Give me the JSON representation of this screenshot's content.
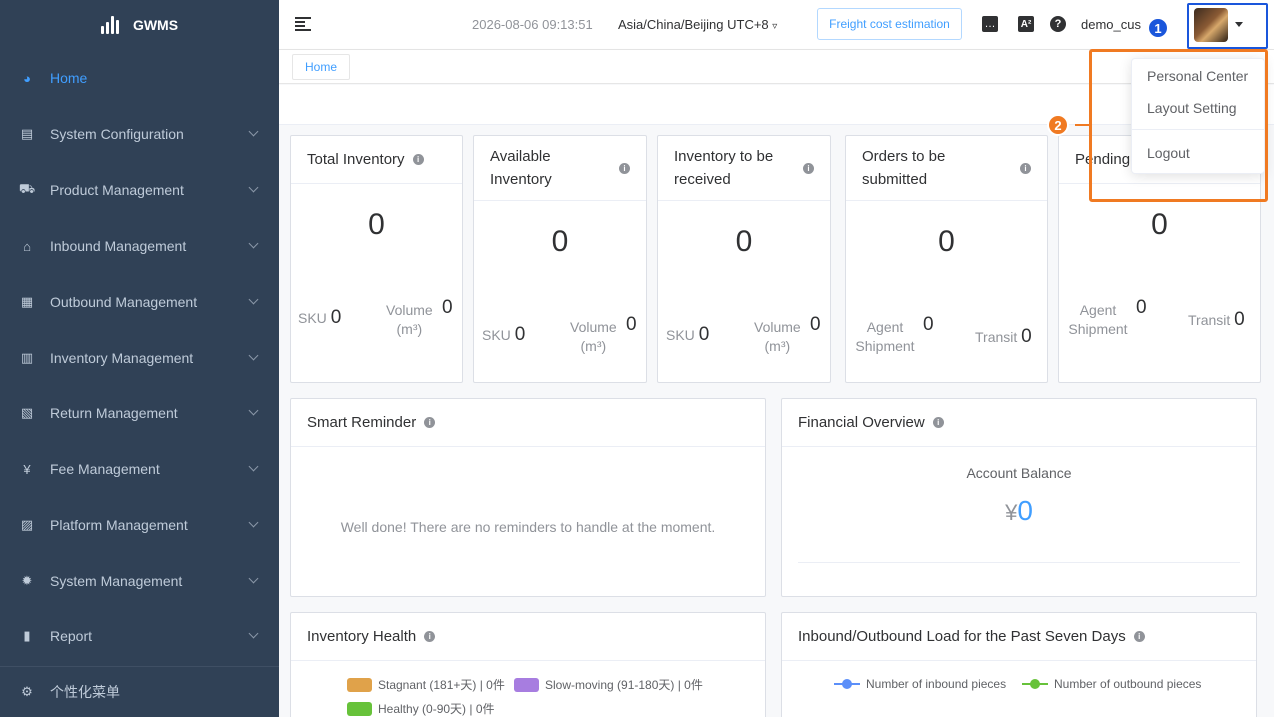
{
  "app": {
    "title": "GWMS"
  },
  "sidebar": {
    "items": [
      {
        "label": "Home",
        "icon": "dashboard-icon",
        "active": true
      },
      {
        "label": "System Configuration",
        "icon": "config-icon"
      },
      {
        "label": "Product Management",
        "icon": "cart-icon"
      },
      {
        "label": "Inbound Management",
        "icon": "home-icon"
      },
      {
        "label": "Outbound Management",
        "icon": "grid-icon"
      },
      {
        "label": "Inventory Management",
        "icon": "table-icon"
      },
      {
        "label": "Return Management",
        "icon": "return-icon"
      },
      {
        "label": "Fee Management",
        "icon": "yen-icon"
      },
      {
        "label": "Platform Management",
        "icon": "shop-icon"
      },
      {
        "label": "System Management",
        "icon": "gear-icon"
      },
      {
        "label": "Report",
        "icon": "bar-chart-icon"
      }
    ],
    "footer_label": "个性化菜单"
  },
  "header": {
    "datetime": "2026-08-06 09:13:51",
    "timezone": "Asia/China/Beijing UTC+8",
    "freight_button": "Freight cost estimation",
    "username": "demo_cus"
  },
  "breadcrumb": {
    "tag": "Home"
  },
  "cards": {
    "total_inventory": {
      "title": "Total Inventory",
      "value": "0",
      "sku_label": "SKU",
      "sku_value": "0",
      "volume_label": "Volume",
      "volume_unit": "(m³)",
      "volume_value": "0"
    },
    "available_inventory": {
      "title": "Available Inventory",
      "value": "0",
      "sku_label": "SKU",
      "sku_value": "0",
      "volume_label": "Volume",
      "volume_unit": "(m³)",
      "volume_value": "0"
    },
    "to_be_received": {
      "title": "Inventory to be received",
      "value": "0",
      "sku_label": "SKU",
      "sku_value": "0",
      "volume_label": "Volume",
      "volume_unit": "(m³)",
      "volume_value": "0"
    },
    "orders_to_submit": {
      "title": "Orders to be submitted",
      "value": "0",
      "agent_label": "Agent Shipment",
      "agent_value": "0",
      "transit_label": "Transit",
      "transit_value": "0"
    },
    "pending": {
      "title": "Pending",
      "value": "0",
      "agent_label": "Agent Shipment",
      "agent_value": "0",
      "transit_label": "Transit",
      "transit_value": "0"
    }
  },
  "smart_reminder": {
    "title": "Smart Reminder",
    "empty": "Well done! There are no reminders to handle at the moment."
  },
  "financial": {
    "title": "Financial Overview",
    "balance_label": "Account Balance",
    "currency": "¥",
    "balance": "0"
  },
  "inventory_health": {
    "title": "Inventory Health",
    "legend": [
      {
        "label": "Stagnant (181+天) | 0件",
        "color": "#e0a24a"
      },
      {
        "label": "Slow-moving (91-180天) | 0件",
        "color": "#a77de0"
      },
      {
        "label": "Healthy (0-90天) | 0件",
        "color": "#67c23a"
      }
    ]
  },
  "load_chart": {
    "title": "Inbound/Outbound Load for the Past Seven Days",
    "legend": [
      {
        "label": "Number of inbound pieces",
        "color": "#5b8ff9"
      },
      {
        "label": "Number of outbound pieces",
        "color": "#67c23a"
      }
    ]
  },
  "user_menu": {
    "items": [
      "Personal Center",
      "Layout Setting",
      "Logout"
    ]
  },
  "annotations": {
    "badge1": "1",
    "badge2": "2"
  }
}
